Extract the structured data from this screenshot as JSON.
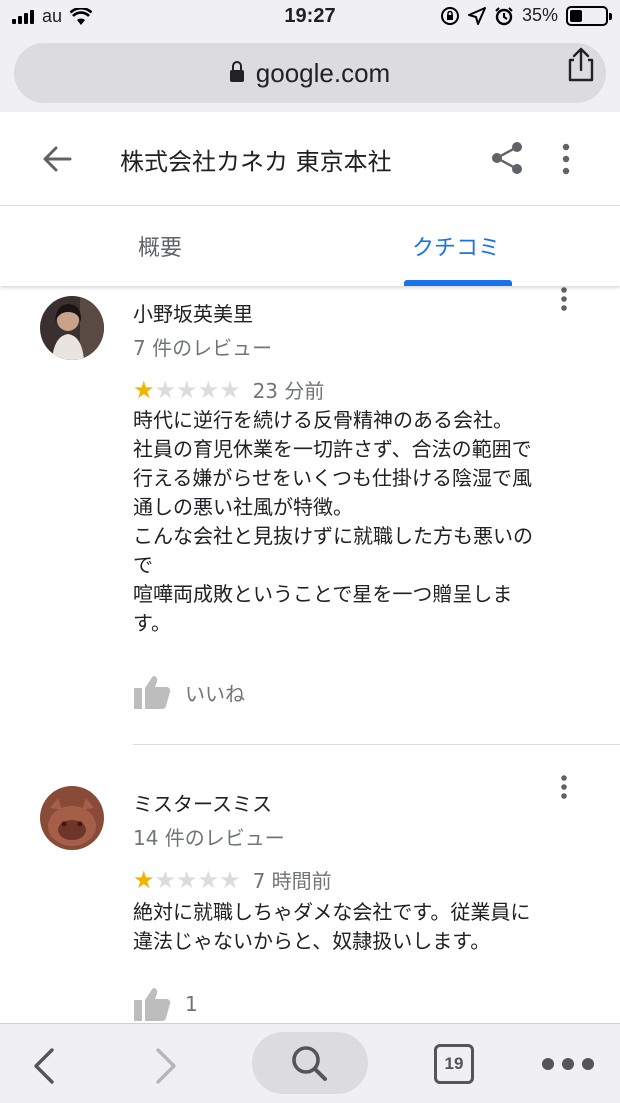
{
  "status_bar": {
    "carrier": "au",
    "time": "19:27",
    "battery": "35%"
  },
  "browser": {
    "url_domain": "google.com",
    "tab_count": "19"
  },
  "header": {
    "title": "株式会社カネカ 東京本社"
  },
  "tabs": [
    {
      "label": "概要",
      "selected": false
    },
    {
      "label": "クチコミ",
      "selected": true
    }
  ],
  "reviews": [
    {
      "author": "小野坂英美里",
      "review_count": "7 件のレビュー",
      "rating": 1,
      "max_rating": 5,
      "time": "23 分前",
      "text": "時代に逆行を続ける反骨精神のある会社。\n社員の育児休業を一切許さず、合法の範囲で\n行える嫌がらせをいくつも仕掛ける陰湿で風\n通しの悪い社風が特徴。\nこんな会社と見抜けずに就職した方も悪いの\nで\n喧嘩両成敗ということで星を一つ贈呈しま\nす。",
      "like_label": "いいね"
    },
    {
      "author": "ミスタースミス",
      "review_count": "14 件のレビュー",
      "rating": 1,
      "max_rating": 5,
      "time": "7 時間前",
      "text": "絶対に就職しちゃダメな会社です。従業員に\n違法じゃないからと、奴隷扱いします。",
      "like_label": "1"
    }
  ],
  "colors": {
    "accent_blue": "#1a73e8",
    "star_on": "#f2b400",
    "star_off": "#dadce0"
  }
}
